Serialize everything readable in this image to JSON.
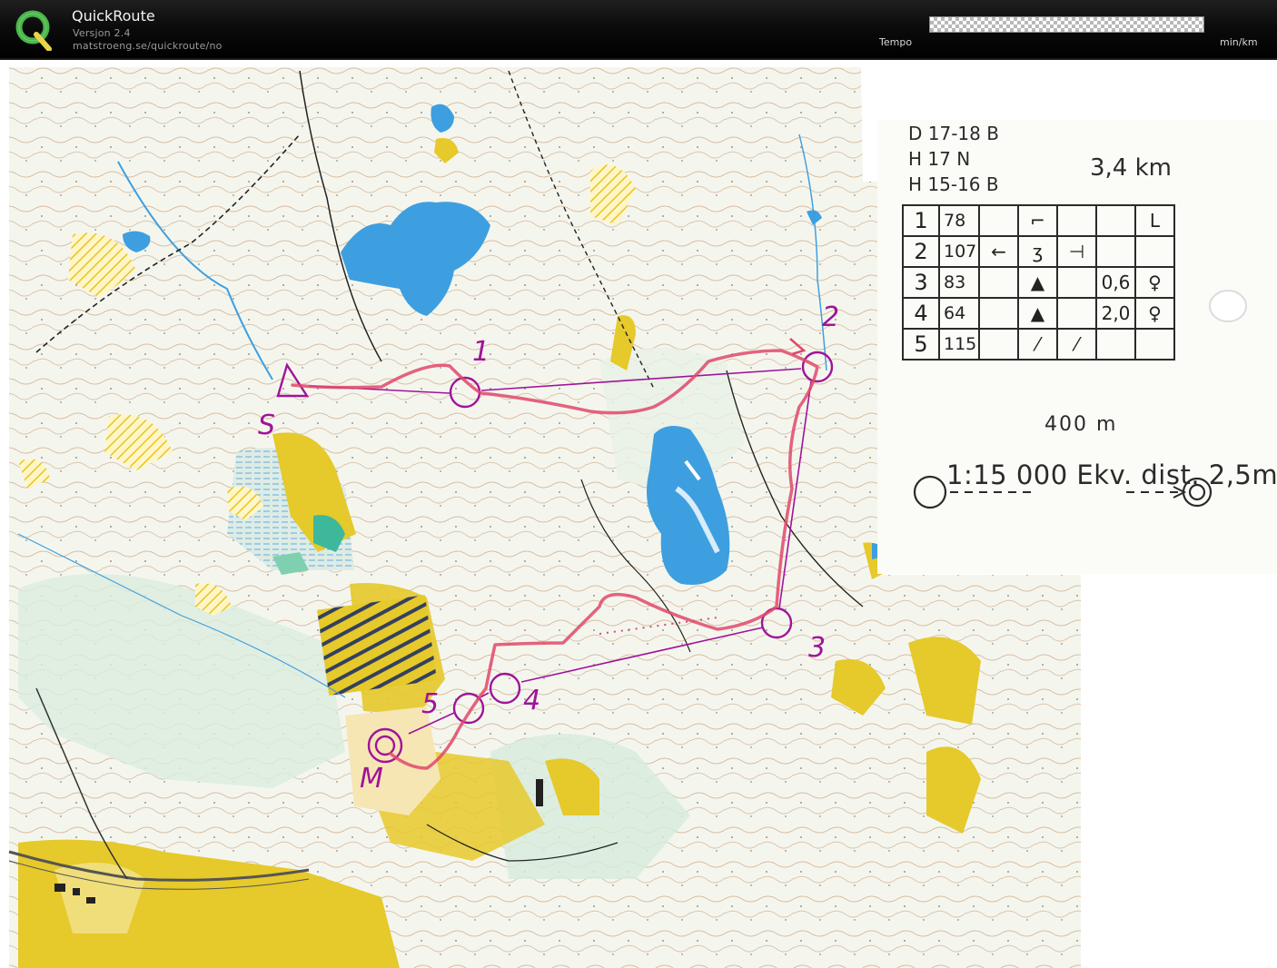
{
  "app": {
    "title": "QuickRoute",
    "version": "Versjon 2.4",
    "url": "matstroeng.se/quickroute/no",
    "logo_letter": "Q",
    "accent_green": "#48b749"
  },
  "tempo": {
    "label": "Tempo",
    "unit": "min/km"
  },
  "map": {
    "classes": [
      "D 17-18 B",
      "H 17 N",
      "H 15-16 B"
    ],
    "distance": "3,4 km",
    "scale": "1:15 000  Ekv. dist. 2,5m",
    "legend_distance": "400 m",
    "control_labels": {
      "start": "S",
      "c1": "1",
      "c2": "2",
      "c3": "3",
      "c4": "4",
      "c5": "5",
      "finish": "M"
    },
    "description_table": [
      [
        "1",
        "78",
        "",
        "⌐",
        "",
        "",
        "L"
      ],
      [
        "2",
        "107",
        "←",
        "ʒ",
        "⊣",
        "",
        ""
      ],
      [
        "3",
        "83",
        "",
        "▲",
        "",
        "0,6",
        "♀"
      ],
      [
        "4",
        "64",
        "",
        "▲",
        "",
        "2,0",
        "♀"
      ],
      [
        "5",
        "115",
        "",
        "⁄",
        "⁄",
        "",
        ""
      ]
    ],
    "colors": {
      "course": "#a0139a",
      "route": "#e0486a",
      "water": "#3e9fe0",
      "open_land": "#e6c92a",
      "contour": "#b07a4a"
    }
  }
}
